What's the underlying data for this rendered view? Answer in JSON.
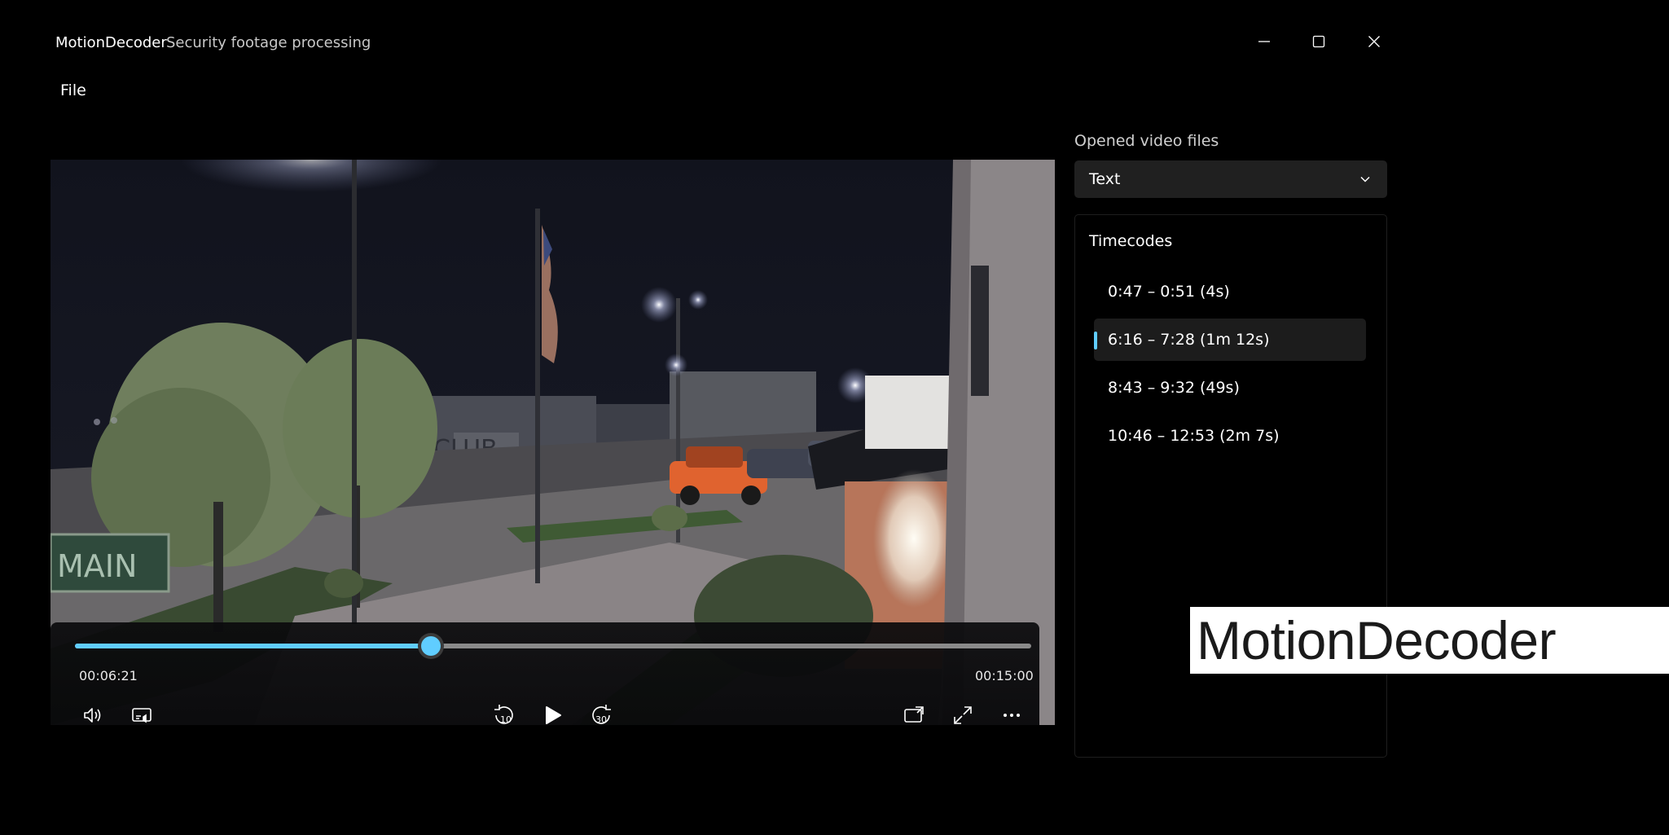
{
  "app": {
    "title": "MotionDecoder",
    "subtitle": "Security footage processing"
  },
  "window_controls": {
    "minimize": "minimize-icon",
    "maximize": "maximize-icon",
    "close": "close-icon"
  },
  "menu": {
    "file": "File"
  },
  "player": {
    "current_time": "00:06:21",
    "total_time": "00:15:00",
    "progress": 0.3722,
    "sign_text": "MAIN",
    "building_text": "CLUB",
    "controls": {
      "left": [
        "volume-icon",
        "audio-caption-icon"
      ],
      "center": [
        "skip-back-10-icon",
        "play-icon",
        "skip-forward-30-icon"
      ],
      "right": [
        "cast-icon",
        "fullscreen-icon",
        "more-icon"
      ],
      "skip_back_label": "10",
      "skip_forward_label": "30"
    }
  },
  "sidebar": {
    "files_label": "Opened video files",
    "files_selected": "Text",
    "timecodes_title": "Timecodes",
    "timecodes": [
      {
        "label": "0:47 – 0:51 (4s)",
        "selected": false
      },
      {
        "label": "6:16 – 7:28 (1m 12s)",
        "selected": true
      },
      {
        "label": "8:43 – 9:32 (49s)",
        "selected": false
      },
      {
        "label": "10:46 – 12:53 (2m 7s)",
        "selected": false
      }
    ]
  },
  "watermark": {
    "text": "MotionDecoder"
  },
  "colors": {
    "accent": "#60cdff",
    "background": "#000000",
    "panel": "#202020"
  }
}
